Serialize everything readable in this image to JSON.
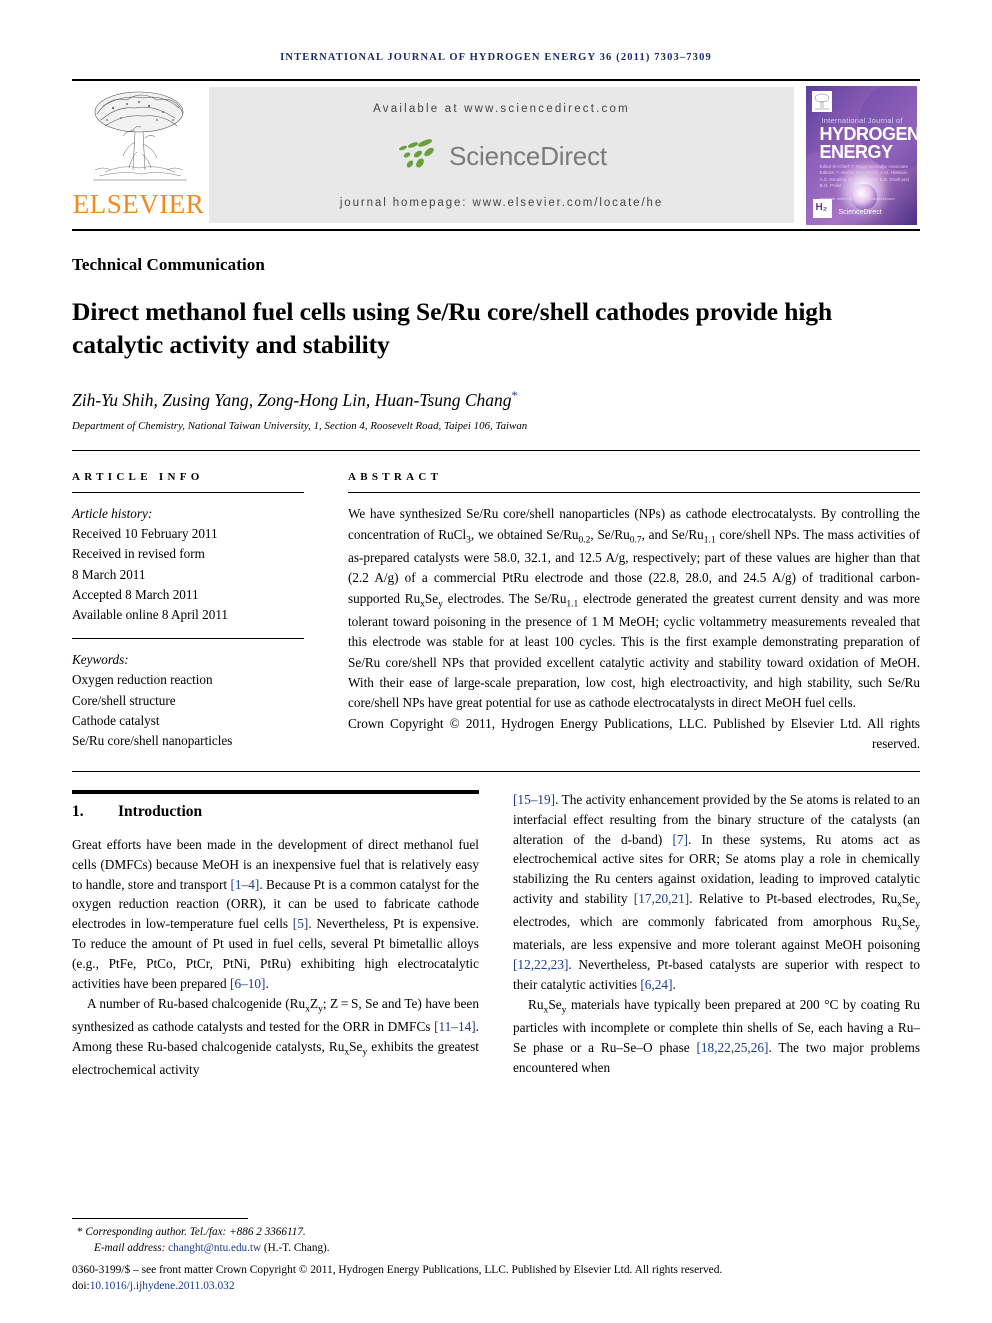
{
  "running_head": "INTERNATIONAL JOURNAL OF HYDROGEN ENERGY 36 (2011) 7303–7309",
  "masthead": {
    "publisher_name": "ELSEVIER",
    "available_at": "Available at www.sciencedirect.com",
    "sciencedirect_word": "ScienceDirect",
    "journal_homepage": "journal homepage: www.elsevier.com/locate/he",
    "cover": {
      "line1": "International Journal of",
      "line2": "HYDROGEN",
      "line3": "ENERGY",
      "editors": "Editor-in-Chief:  T. Nejat Veziroğlu\nAssociate Editors:  F. Barbir, S.A. Sherif, A.M. Hossain,\nA.Z. Ismailov, D.Y. Goswami,\nE.E. Shafi and B.G. Pollet",
      "h2_badge": "H₂",
      "sciencedirect_badge": "ScienceDirect",
      "bottom_note": "Available online at www.sciencedirect.com"
    }
  },
  "article_type": "Technical Communication",
  "title": "Direct methanol fuel cells using Se/Ru core/shell cathodes provide high catalytic activity and stability",
  "authors": "Zih-Yu Shih, Zusing Yang, Zong-Hong Lin, Huan-Tsung Chang",
  "author_star": "*",
  "affiliation": "Department of Chemistry, National Taiwan University, 1, Section 4, Roosevelt Road, Taipei 106, Taiwan",
  "article_info": {
    "heading": "ARTICLE INFO",
    "history_label": "Article history:",
    "history": [
      "Received 10 February 2011",
      "Received in revised form",
      "8 March 2011",
      "Accepted 8 March 2011",
      "Available online 8 April 2011"
    ],
    "keywords_label": "Keywords:",
    "keywords": [
      "Oxygen reduction reaction",
      "Core/shell structure",
      "Cathode catalyst",
      "Se/Ru core/shell nanoparticles"
    ]
  },
  "abstract": {
    "heading": "ABSTRACT",
    "body_html": "We have synthesized Se/Ru core/shell nanoparticles (NPs) as cathode electrocatalysts. By controlling the concentration of RuCl<sub>3</sub>, we obtained Se/Ru<sub>0.2</sub>, Se/Ru<sub>0.7</sub>, and Se/Ru<sub>1.1</sub> core/shell NPs. The mass activities of as-prepared catalysts were 58.0, 32.1, and 12.5 A/g, respectively; part of these values are higher than that (2.2 A/g) of a commercial PtRu electrode and those (22.8, 28.0, and 24.5 A/g) of traditional carbon-supported Ru<sub>x</sub>Se<sub>y</sub> electrodes. The Se/Ru<sub>1.1</sub> electrode generated the greatest current density and was more tolerant toward poisoning in the presence of 1 M MeOH; cyclic voltammetry measurements revealed that this electrode was stable for at least 100 cycles. This is the first example demonstrating preparation of Se/Ru core/shell NPs that provided excellent catalytic activity and stability toward oxidation of MeOH. With their ease of large-scale preparation, low cost, high electroactivity, and high stability, such Se/Ru core/shell NPs have great potential for use as cathode electrocatalysts in direct MeOH fuel cells.",
    "copyright_html": "Crown Copyright © 2011, Hydrogen Energy Publications, LLC. Published by Elsevier Ltd. All rights reserved."
  },
  "introduction": {
    "number": "1.",
    "heading": "Introduction",
    "left_paragraphs_html": [
      "Great efforts have been made in the development of direct methanol fuel cells (DMFCs) because MeOH is an inexpensive fuel that is relatively easy to handle, store and transport <span class=\"ref\">[1&#8211;4]</span>. Because Pt is a common catalyst for the oxygen reduction reaction (ORR), it can be used to fabricate cathode electrodes in low-temperature fuel cells <span class=\"ref\">[5]</span>. Nevertheless, Pt is expensive. To reduce the amount of Pt used in fuel cells, several Pt bimetallic alloys (e.g., PtFe, PtCo, PtCr, PtNi, PtRu) exhibiting high electrocatalytic activities have been prepared <span class=\"ref\">[6&#8211;10]</span>.",
      "A number of Ru-based chalcogenide (Ru<sub>x</sub>Z<sub>y</sub>; Z&#8201;=&#8201;S, Se and Te) have been synthesized as cathode catalysts and tested for the ORR in DMFCs <span class=\"ref\">[11&#8211;14]</span>. Among these Ru-based chalcogenide catalysts, Ru<sub>x</sub>Se<sub>y</sub> exhibits the greatest electrochemical activity"
    ],
    "right_paragraphs_html": [
      "<span class=\"ref\">[15&#8211;19]</span>. The activity enhancement provided by the Se atoms is related to an interfacial effect resulting from the binary structure of the catalysts (an alteration of the d-band) <span class=\"ref\">[7]</span>. In these systems, Ru atoms act as electrochemical active sites for ORR; Se atoms play a role in chemically stabilizing the Ru centers against oxidation, leading to improved catalytic activity and stability <span class=\"ref\">[17,20,21]</span>. Relative to Pt-based electrodes, Ru<sub>x</sub>Se<sub>y</sub> electrodes, which are commonly fabricated from amorphous Ru<sub>x</sub>Se<sub>y</sub> materials, are less expensive and more tolerant against MeOH poisoning <span class=\"ref\">[12,22,23]</span>. Nevertheless, Pt-based catalysts are superior with respect to their catalytic activities <span class=\"ref\">[6,24]</span>.",
      "Ru<sub>x</sub>Se<sub>y</sub> materials have typically been prepared at 200&nbsp;°C by coating Ru particles with incomplete or complete thin shells of Se, each having a Ru&#8211;Se phase or a Ru&#8211;Se&#8211;O phase <span class=\"ref\">[18,22,25,26]</span>. The two major problems encountered when"
    ]
  },
  "footer": {
    "corresponding_star": "*",
    "corresponding_text": "Corresponding author. Tel./fax: +886 2 3366117.",
    "email_label": "E-mail address:",
    "email": "changht@ntu.edu.tw",
    "email_suffix": "(H.-T. Chang).",
    "issn_line_html": "0360-3199/$ &#8211; see front matter Crown Copyright © 2011, Hydrogen Energy Publications, LLC. Published by Elsevier Ltd. All rights reserved.",
    "doi_label": "doi:",
    "doi": "10.1016/j.ijhydene.2011.03.032"
  },
  "colors": {
    "elsevier_orange": "#f08a21",
    "running_head_navy": "#1b2a6b",
    "reference_blue": "#1b3a8c",
    "sciencedirect_green": "#6aa03c",
    "sciencedirect_gray": "#7b7b7b"
  }
}
